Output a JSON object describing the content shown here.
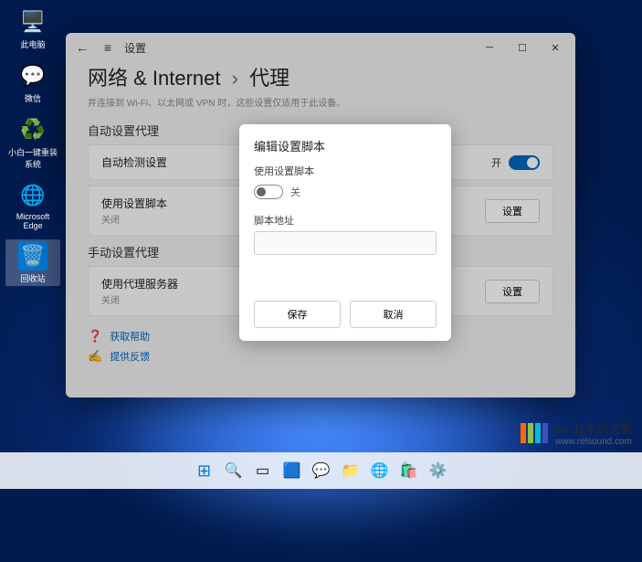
{
  "desktop": {
    "icons": [
      {
        "label": "此电脑",
        "glyph": "🖥️"
      },
      {
        "label": "微信",
        "glyph": "💬"
      },
      {
        "label": "小白一键重装系统",
        "glyph": "♻️"
      },
      {
        "label": "Microsoft Edge",
        "glyph": "🌐"
      },
      {
        "label": "回收站",
        "glyph": "🗑️"
      }
    ]
  },
  "window": {
    "app_name": "设置",
    "breadcrumb": {
      "root": "网络 & Internet",
      "current": "代理"
    },
    "subtext": "并连接到 Wi-Fi、以太网或 VPN 时，这些设置仅适用于此设备。",
    "sections": {
      "auto": {
        "title": "自动设置代理",
        "rows": [
          {
            "title": "自动检测设置",
            "sub": "",
            "action": "toggle",
            "state_label": "开"
          },
          {
            "title": "使用设置脚本",
            "sub": "关闭",
            "action": "button",
            "btn": "设置"
          }
        ]
      },
      "manual": {
        "title": "手动设置代理",
        "rows": [
          {
            "title": "使用代理服务器",
            "sub": "关闭",
            "action": "button",
            "btn": "设置"
          }
        ]
      }
    },
    "footer": [
      {
        "icon": "❓",
        "label": "获取帮助"
      },
      {
        "icon": "✍",
        "label": "提供反馈"
      }
    ]
  },
  "modal": {
    "title": "编辑设置脚本",
    "toggle_heading": "使用设置脚本",
    "toggle_state": "关",
    "field_label": "脚本地址",
    "field_value": "",
    "save": "保存",
    "cancel": "取消"
  },
  "taskbar": {
    "items": [
      "start",
      "search",
      "taskview",
      "widgets",
      "chat",
      "explorer",
      "edge",
      "store",
      "settings"
    ]
  },
  "watermark": {
    "brand": "win11系统之家",
    "url": "www.relsound.com",
    "colors": [
      "#ff6a00",
      "#8bc34a",
      "#00bcd4",
      "#3f51b5"
    ]
  }
}
